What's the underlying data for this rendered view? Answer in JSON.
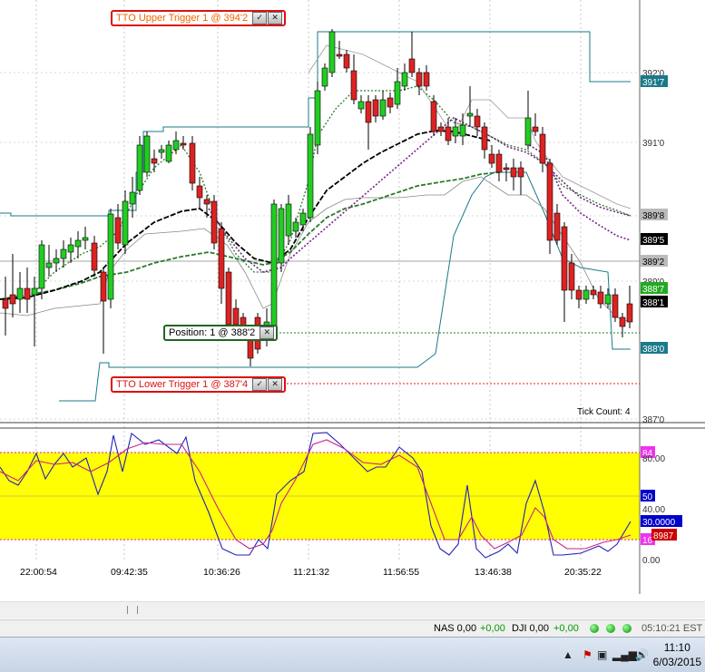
{
  "chart": {
    "price_labels": [
      {
        "text": "392'0",
        "style": "plain"
      },
      {
        "text": "391'7",
        "style": "teal"
      },
      {
        "text": "391'0",
        "style": "plain"
      },
      {
        "text": "389'8",
        "style": "gray"
      },
      {
        "text": "389'5",
        "style": "black"
      },
      {
        "text": "389'2",
        "style": "gray"
      },
      {
        "text": "389'0",
        "style": "plain"
      },
      {
        "text": "388'7",
        "style": "green"
      },
      {
        "text": "388'1",
        "style": "black"
      },
      {
        "text": "388'0",
        "style": "teal"
      },
      {
        "text": "387'0",
        "style": "plain"
      }
    ],
    "tick_count": "Tick Count:  4",
    "osc_labels": [
      {
        "text": "84",
        "style": "magenta"
      },
      {
        "text": "80.00",
        "style": "plain"
      },
      {
        "text": "50",
        "style": "blue"
      },
      {
        "text": "40.00",
        "style": "plain"
      },
      {
        "text": "30.0000",
        "style": "blue"
      },
      {
        "text": "16",
        "style": "magenta"
      },
      {
        "text": "8987",
        "style": "red"
      },
      {
        "text": "0.00",
        "style": "plain"
      }
    ],
    "time_labels": [
      "22:00:54",
      "09:42:35",
      "10:36:26",
      "11:21:32",
      "11:56:55",
      "13:46:38",
      "20:35:22"
    ]
  },
  "orders": {
    "upper": "TTO Upper Trigger 1 @ 394'2",
    "position": "Position: 1 @ 388'2",
    "lower": "TTO Lower Trigger 1 @ 387'4"
  },
  "statusbar": {
    "nas_label": "NAS 0,00",
    "nas_change": "+0,00",
    "dji_label": "DJI 0,00",
    "dji_change": "+0,00",
    "time": "05:10:21 EST"
  },
  "taskbar": {
    "time": "11:10",
    "date": "6/03/2015"
  },
  "colors": {
    "up": "#22cc22",
    "down": "#dd2222",
    "teal": "#1a7a8a",
    "osc_fill": "#ffff00"
  }
}
